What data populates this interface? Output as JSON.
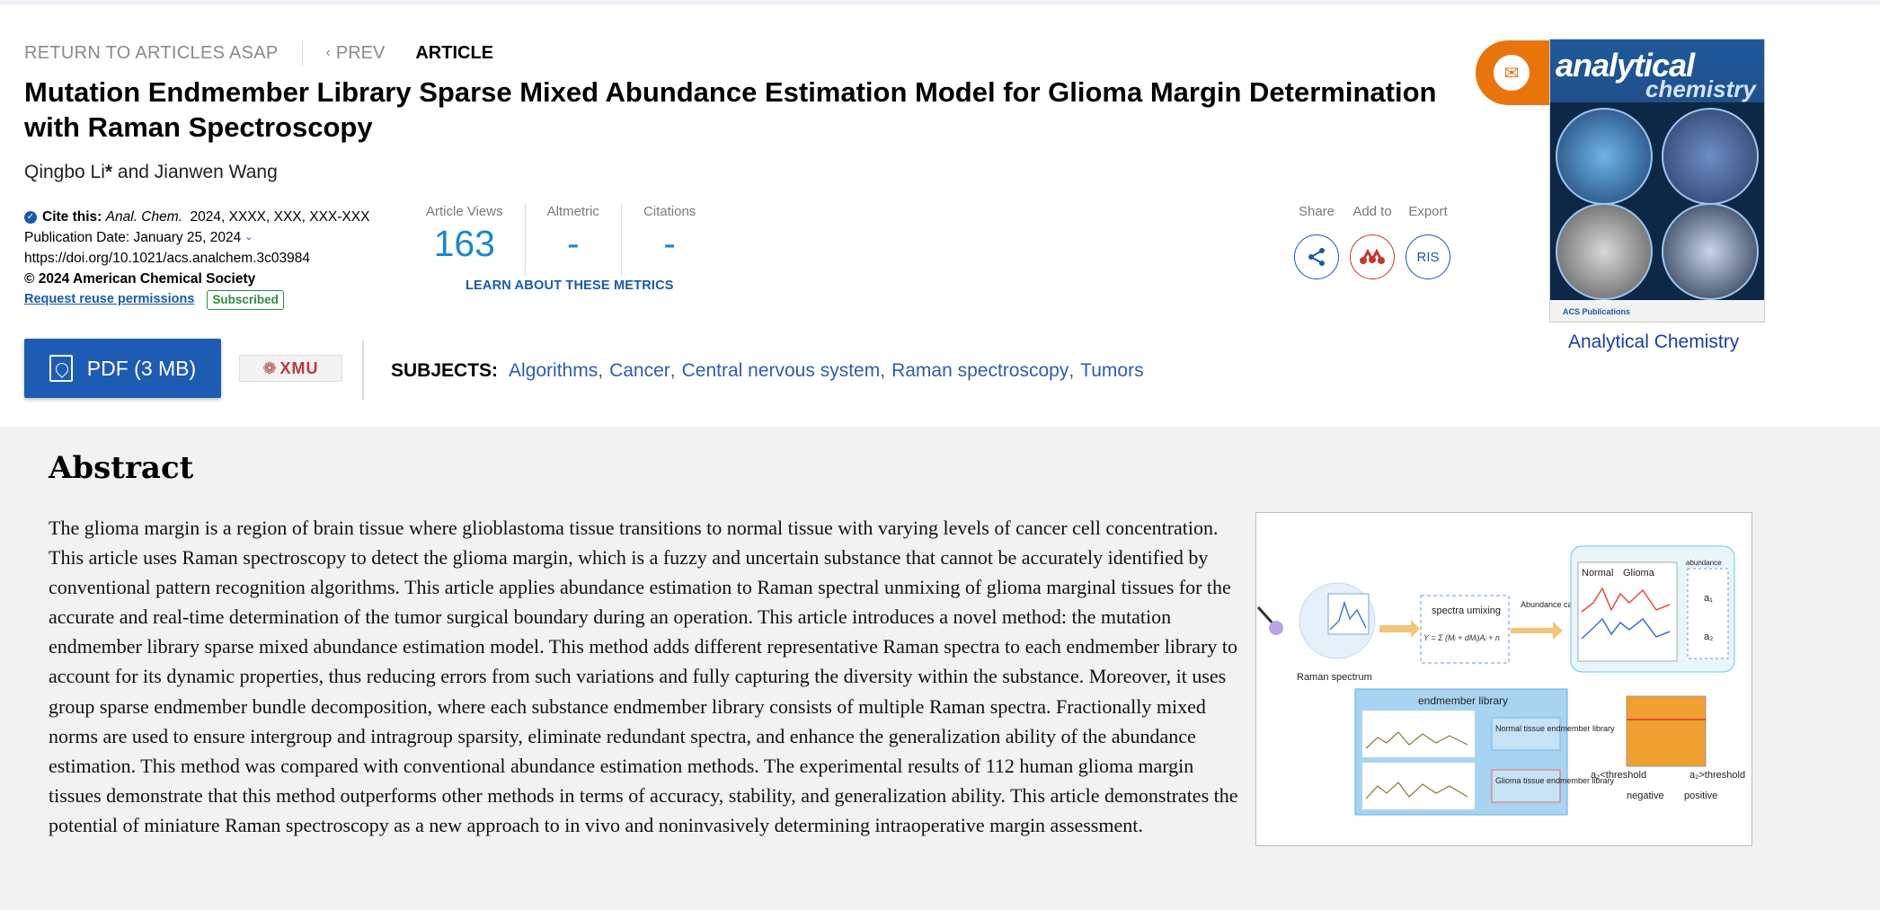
{
  "nav": {
    "return_label": "RETURN TO ARTICLES ASAP",
    "prev_label": "PREV",
    "article_label": "ARTICLE"
  },
  "article": {
    "title": "Mutation Endmember Library Sparse Mixed Abundance Estimation Model for Glioma Margin Determination with Raman Spectroscopy",
    "authors_prefix": "Qingbo Li",
    "authors_star": "*",
    "authors_rest": " and Jianwen Wang"
  },
  "citation": {
    "cite_label": "Cite this:",
    "journal_abbrev": "Anal. Chem.",
    "cite_rest": "2024, XXXX, XXX, XXX-XXX",
    "pub_date": "Publication Date: January 25, 2024",
    "doi": "https://doi.org/10.1021/acs.analchem.3c03984",
    "copyright": "© 2024 American Chemical Society",
    "reuse_link": "Request reuse permissions",
    "subscribed_badge": "Subscribed"
  },
  "metrics": {
    "views_label": "Article Views",
    "views_value": "163",
    "altmetric_label": "Altmetric",
    "altmetric_value": "-",
    "citations_label": "Citations",
    "citations_value": "-",
    "learn_link": "LEARN ABOUT THESE METRICS"
  },
  "actions": {
    "share_label": "Share",
    "add_label": "Add to",
    "export_label": "Export",
    "ris_label": "RIS"
  },
  "pdf_button": "PDF (3 MB)",
  "institution_logo": "XMU",
  "subjects": {
    "label": "SUBJECTS:",
    "items": [
      "Algorithms",
      "Cancer",
      "Central nervous system",
      "Raman spectroscopy",
      "Tumors"
    ]
  },
  "journal": {
    "cover_title_1": "analytical",
    "cover_title_2": "chemistry",
    "cover_footer": "ACS Publications",
    "name": "Analytical Chemistry"
  },
  "abstract": {
    "heading": "Abstract",
    "text": "The glioma margin is a region of brain tissue where glioblastoma tissue transitions to normal tissue with varying levels of cancer cell concentration. This article uses Raman spectroscopy to detect the glioma margin, which is a fuzzy and uncertain substance that cannot be accurately identified by conventional pattern recognition algorithms. This article applies abundance estimation to Raman spectral unmixing of glioma marginal tissues for the accurate and real-time determination of the tumor surgical boundary during an operation. This article introduces a novel method: the mutation endmember library sparse mixed abundance estimation model. This method adds different representative Raman spectra to each endmember library to account for its dynamic properties, thus reducing errors from such variations and fully capturing the diversity within the substance. Moreover, it uses group sparse endmember bundle decomposition, where each substance endmember library consists of multiple Raman spectra. Fractionally mixed norms are used to ensure intergroup and intragroup sparsity, eliminate redundant spectra, and enhance the generalization ability of the abundance estimation. This method was compared with conventional abundance estimation methods. The experimental results of 112 human glioma margin tissues demonstrate that this method outperforms other methods in terms of accuracy, stability, and generalization ability. This article demonstrates the potential of miniature Raman spectroscopy as a new approach to in vivo and noninvasively determining intraoperative margin assessment."
  },
  "toc_graphic": {
    "raman_label": "Raman spectrum",
    "unmix_label": "spectra umixing",
    "formula": "Y = Σ (Mᵢ + dMᵢ)Aᵢ + n",
    "abundance_calc": "Abundance calculation",
    "legend_normal": "Normal",
    "legend_glioma": "Glioma",
    "abundance_label": "abundance",
    "a1": "a₁",
    "a2": "a₂",
    "library_title": "endmember library",
    "normal_lib": "Normal tissue endmember library",
    "glioma_lib": "Glioma tissue endmember library",
    "neg_cond": "a₂<threshold",
    "pos_cond": "a₂>threshold",
    "negative": "negative",
    "positive": "positive"
  }
}
